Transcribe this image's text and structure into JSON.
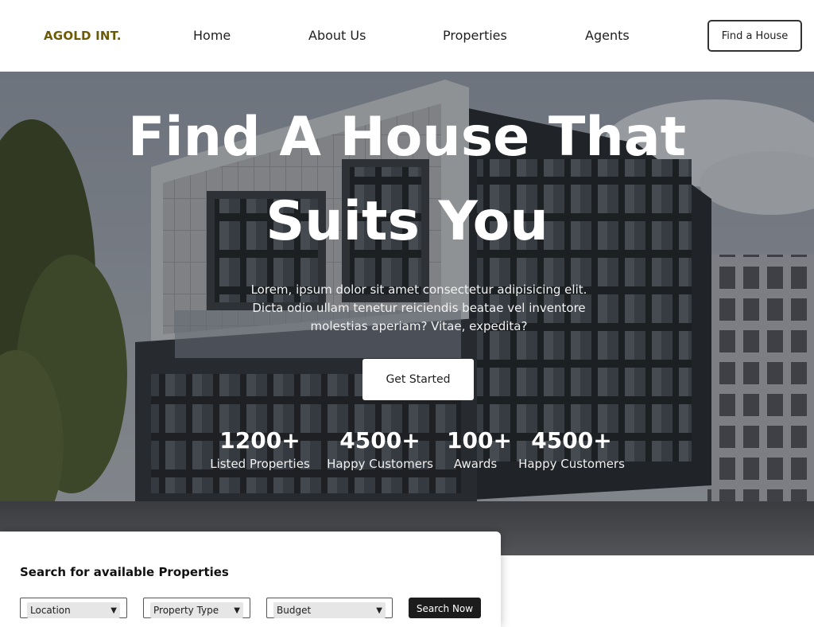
{
  "brand": {
    "name": "AGOLD INT.",
    "color": "#6b5a06"
  },
  "nav": {
    "items": [
      {
        "label": "Home"
      },
      {
        "label": "About Us"
      },
      {
        "label": "Properties"
      },
      {
        "label": "Agents"
      }
    ],
    "cta_label": "Find a House"
  },
  "hero": {
    "title": "Find A House That Suits You",
    "description": "Lorem, ipsum dolor sit amet consectetur adipisicing elit. Dicta odio ullam tenetur reiciendis beatae vel inventore molestias aperiam? Vitae, expedita?",
    "cta_label": "Get Started",
    "stats": [
      {
        "value": "1200+",
        "label": "Listed Properties"
      },
      {
        "value": "4500+",
        "label": "Happy Customers"
      },
      {
        "value": "100+",
        "label": "Awards"
      },
      {
        "value": "4500+",
        "label": "Happy Customers"
      }
    ]
  },
  "search": {
    "title": "Search for available Properties",
    "location_value": "Location",
    "type_value": "Property Type",
    "budget_value": "Budget",
    "button_label": "Search Now"
  }
}
